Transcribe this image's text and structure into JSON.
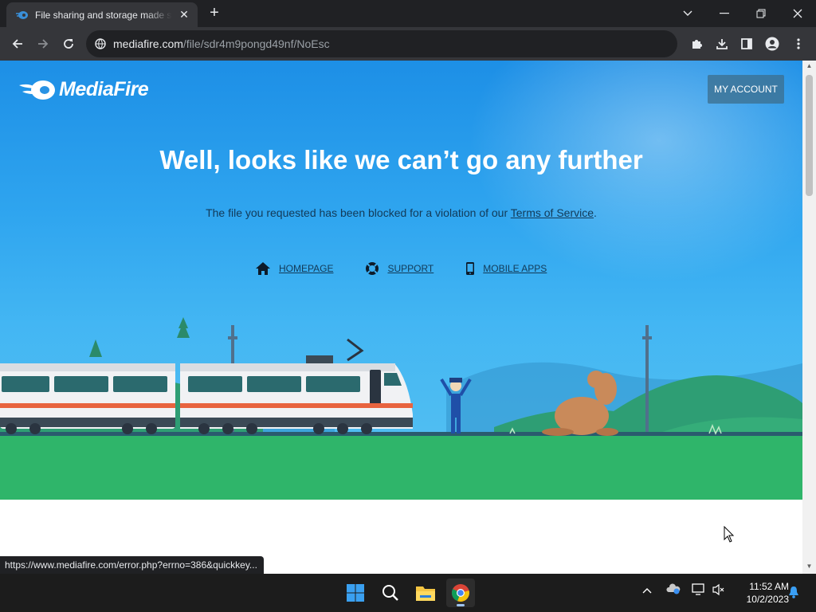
{
  "browser": {
    "tab_title": "File sharing and storage made simple",
    "url_host": "mediafire.com",
    "url_path": "/file/sdr4m9pongd49nf/NoEsc",
    "status_url": "https://www.mediafire.com/error.php?errno=386&quickkey..."
  },
  "page": {
    "logo_text": "MediaFire",
    "account_button": "MY ACCOUNT",
    "headline": "Well, looks like we can’t go any further",
    "message_before": "The file you requested has been blocked for a violation of our ",
    "message_link": "Terms of Service",
    "message_after": ".",
    "nav": [
      {
        "label": "HOMEPAGE",
        "icon": "home-icon"
      },
      {
        "label": "SUPPORT",
        "icon": "lifebuoy-icon"
      },
      {
        "label": "MOBILE APPS",
        "icon": "phone-icon"
      }
    ]
  },
  "taskbar": {
    "time": "11:52 AM",
    "date": "10/2/2023"
  },
  "colors": {
    "hero_top": "#1d8fe6",
    "ground": "#2fb56a",
    "chrome_dark": "#202124"
  }
}
